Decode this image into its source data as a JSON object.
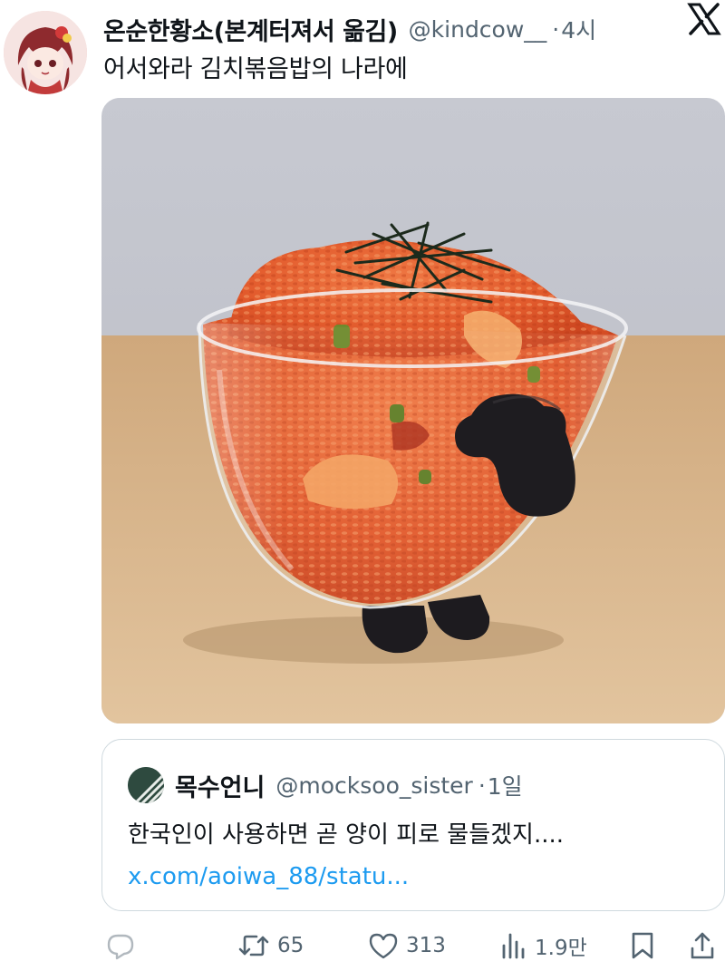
{
  "tweet": {
    "author": {
      "display_name": "온순한황소(본계터져서 옮김)",
      "handle": "@kindcow__",
      "separator": "·",
      "time": "4시"
    },
    "text": "어서와라 김치볶음밥의 나라에",
    "brand_icon": "x-logo-icon"
  },
  "quote": {
    "author": {
      "display_name": "목수언니",
      "handle": "@mocksoo_sister",
      "separator": "·",
      "time": "1일"
    },
    "text": "한국인이 사용하면 곧 양이 피로 물들겠지....",
    "link": "x.com/aoiwa_88/statu..."
  },
  "actions": {
    "reply_icon": "reply-icon",
    "retweet_count": "65",
    "like_count": "313",
    "views_count": "1.9만",
    "bookmark_icon": "bookmark-icon",
    "share_icon": "share-icon"
  },
  "colors": {
    "text_primary": "#0f1419",
    "text_secondary": "#536471",
    "link": "#1d9bf0",
    "border": "#cfd9de"
  }
}
